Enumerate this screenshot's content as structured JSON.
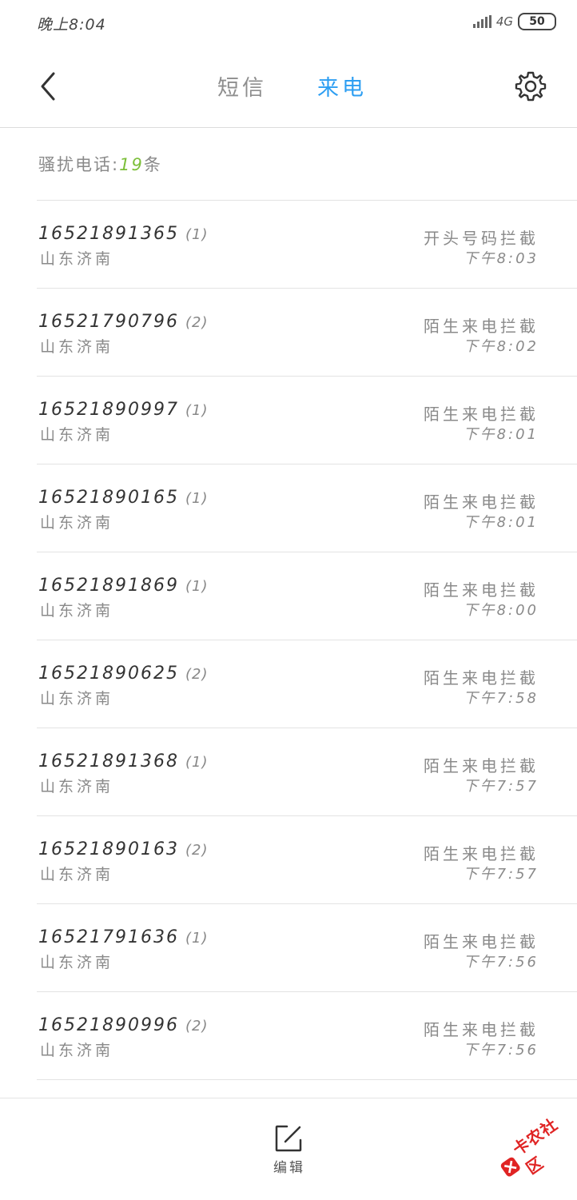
{
  "status_bar": {
    "time": "晚上8:04",
    "network": "4G",
    "battery": "50"
  },
  "header": {
    "tabs": [
      "短信",
      "来电"
    ],
    "active_tab": 1
  },
  "summary": {
    "prefix": "骚扰电话:",
    "count": "19",
    "suffix": "条"
  },
  "calls": [
    {
      "number": "16521891365",
      "count": "(1)",
      "location": "山东济南",
      "type": "开头号码拦截",
      "time": "下午8:03"
    },
    {
      "number": "16521790796",
      "count": "(2)",
      "location": "山东济南",
      "type": "陌生来电拦截",
      "time": "下午8:02"
    },
    {
      "number": "16521890997",
      "count": "(1)",
      "location": "山东济南",
      "type": "陌生来电拦截",
      "time": "下午8:01"
    },
    {
      "number": "16521890165",
      "count": "(1)",
      "location": "山东济南",
      "type": "陌生来电拦截",
      "time": "下午8:01"
    },
    {
      "number": "16521891869",
      "count": "(1)",
      "location": "山东济南",
      "type": "陌生来电拦截",
      "time": "下午8:00"
    },
    {
      "number": "16521890625",
      "count": "(2)",
      "location": "山东济南",
      "type": "陌生来电拦截",
      "time": "下午7:58"
    },
    {
      "number": "16521891368",
      "count": "(1)",
      "location": "山东济南",
      "type": "陌生来电拦截",
      "time": "下午7:57"
    },
    {
      "number": "16521890163",
      "count": "(2)",
      "location": "山东济南",
      "type": "陌生来电拦截",
      "time": "下午7:57"
    },
    {
      "number": "16521791636",
      "count": "(1)",
      "location": "山东济南",
      "type": "陌生来电拦截",
      "time": "下午7:56"
    },
    {
      "number": "16521890996",
      "count": "(2)",
      "location": "山东济南",
      "type": "陌生来电拦截",
      "time": "下午7:56"
    }
  ],
  "bottom_bar": {
    "edit_label": "编辑"
  },
  "watermark": {
    "text": "卡农社区"
  },
  "icons": {
    "back": "back-arrow-icon",
    "settings": "gear-icon",
    "edit": "edit-icon",
    "watermark_logo": "kanong-logo-icon"
  },
  "colors": {
    "accent": "#2d9ef2",
    "count_highlight": "#7cbf3a",
    "watermark": "#e02424"
  }
}
